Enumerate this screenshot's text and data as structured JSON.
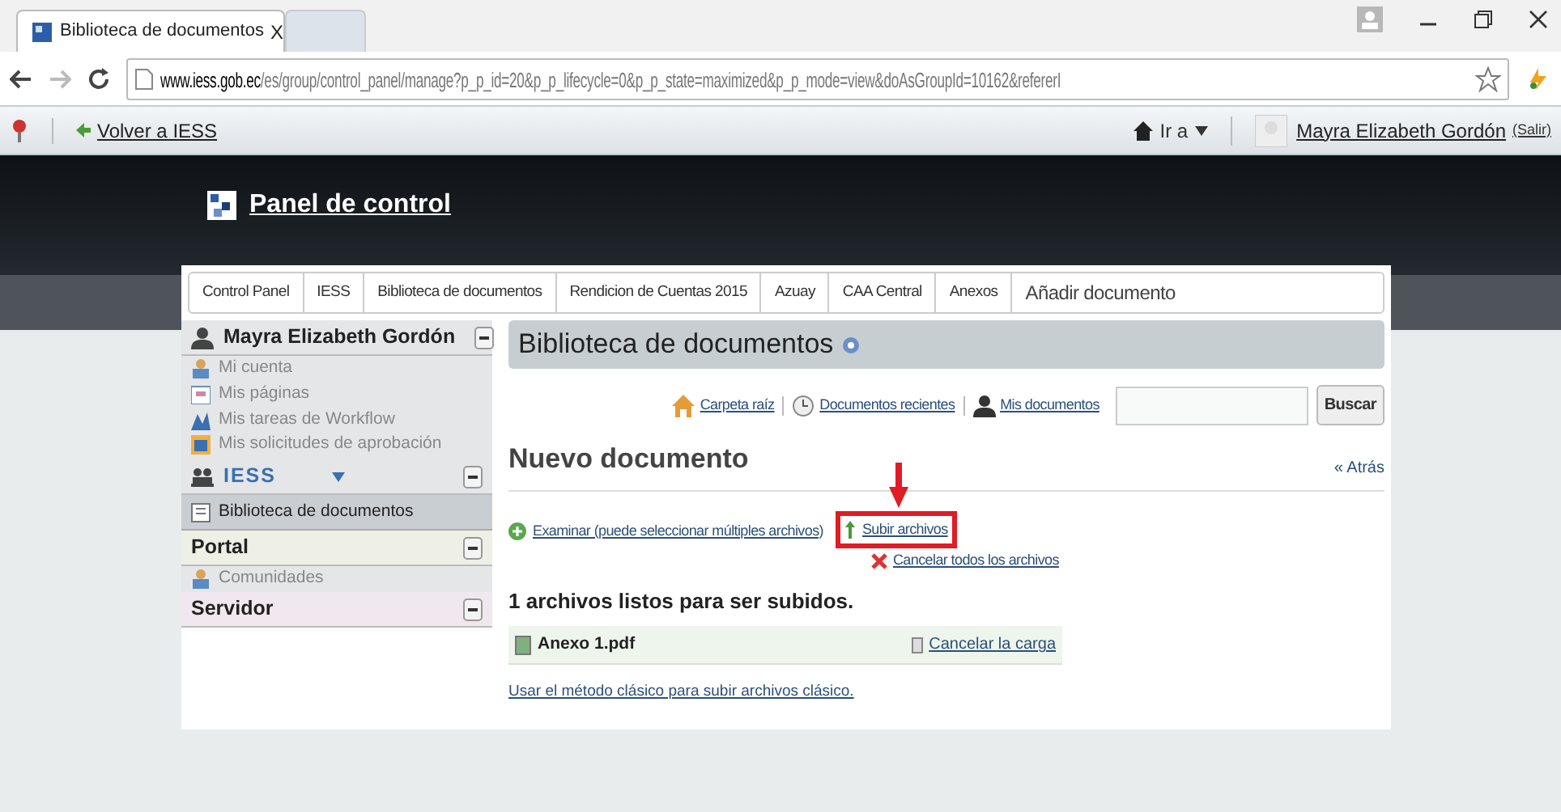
{
  "browser": {
    "tabs": [
      {
        "title": "Biblioteca de documentos",
        "close": "X",
        "selected": true
      },
      {
        "selected": false
      }
    ],
    "url_host": "www.iess.gob.ec",
    "url_path": "/es/group/control_panel/manage?p_p_id=20&p_p_lifecycle=0&p_p_state=maximized&p_p_mode=view&doAsGroupId=10162&refererI"
  },
  "dockbar": {
    "back_link": "Volver a IESS",
    "goto": "Ir a",
    "user": "Mayra Elizabeth Gordón",
    "signout": "(Salir)"
  },
  "header": {
    "title": "Panel de control"
  },
  "breadcrumb": [
    "Control Panel",
    "IESS",
    "Biblioteca de documentos",
    "Rendicion de Cuentas 2015",
    "Azuay",
    "CAA Central",
    "Anexos",
    "Añadir documento"
  ],
  "sidebar": [
    {
      "title": "Mayra Elizabeth Gordón",
      "kind": "user",
      "items": [
        {
          "label": "Mi cuenta",
          "selected": false
        },
        {
          "label": "Mis páginas",
          "selected": false
        },
        {
          "label": "Mis tareas de Workflow",
          "selected": false
        },
        {
          "label": "Mis solicitudes de aprobación",
          "selected": false
        }
      ]
    },
    {
      "title": "IESS",
      "kind": "site",
      "items": [
        {
          "label": "Biblioteca de documentos",
          "selected": true
        }
      ]
    },
    {
      "title": "Portal",
      "kind": "plain",
      "items": [
        {
          "label": "Comunidades",
          "selected": false
        }
      ]
    },
    {
      "title": "Servidor",
      "kind": "server"
    }
  ],
  "portlet": {
    "title": "Biblioteca de documentos",
    "nav": [
      {
        "label": "Carpeta raíz",
        "kind": "home"
      },
      {
        "label": "Documentos recientes",
        "kind": "clock"
      },
      {
        "label": "Mis documentos",
        "kind": "user"
      }
    ],
    "search_button": "Buscar",
    "heading": "Nuevo documento",
    "back": "« Atrás",
    "browse": "Examinar (puede seleccionar múltiples archivos)",
    "upload": "Subir archivos",
    "cancel_all": "Cancelar todos los archivos",
    "ready": "1 archivos listos para ser subidos.",
    "files": [
      {
        "name": "Anexo 1.pdf",
        "cancel": "Cancelar la carga"
      }
    ],
    "classic": "Usar el método clásico para subir archivos clásico."
  }
}
